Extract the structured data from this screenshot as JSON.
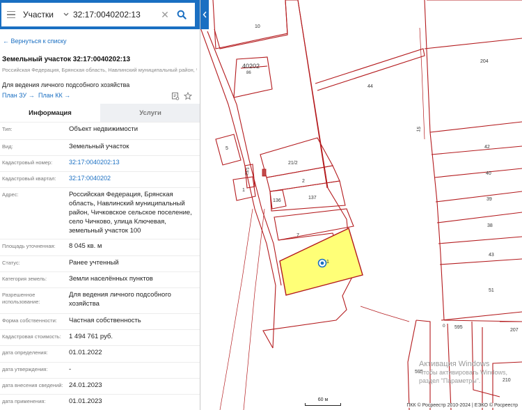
{
  "search": {
    "layer": "Участки",
    "query": "32:17:0040202:13"
  },
  "icons": {
    "menu": "hamburger-icon",
    "dropdown": "chevron-down-icon",
    "clear": "close-icon",
    "search": "search-icon",
    "collapse": "chevron-left-icon",
    "print": "print-icon",
    "favorite": "star-icon",
    "marker": "location-marker-icon"
  },
  "colors": {
    "accent": "#1a6fc2",
    "parcel_border": "#b3191c",
    "parcel_fill": "#ffff77"
  },
  "panel": {
    "back": "← Вернуться к списку",
    "title": "Земельный участок 32:17:0040202:13",
    "address": "Российская Федерация, Брянская область, Навлинский муниципальный район, Чичковское сельское поселение, село Чичково, улица Ключевая, земельный...",
    "purpose": "Для ведения личного подсобного хозяйства",
    "plan_zu": "План ЗУ →",
    "plan_kk": "План КК →"
  },
  "tabs": {
    "info": "Информация",
    "services": "Услуги"
  },
  "fields": [
    {
      "label": "Тип:",
      "value": "Объект недвижимости"
    },
    {
      "label": "Вид:",
      "value": "Земельный участок"
    },
    {
      "label": "Кадастровый номер:",
      "value": "32:17:0040202:13"
    },
    {
      "label": "Кадастровый квартал:",
      "value": "32:17:0040202"
    },
    {
      "label": "Адрес:",
      "value": "Российская Федерация, Брянская область, Навлинский муниципальный район, Чичковское сельское поселение, село Чичково, улица Ключевая, земельный участок 100"
    },
    {
      "label": "Площадь уточненная:",
      "value": "8 045 кв. м"
    },
    {
      "label": "Статус:",
      "value": "Ранее учтенный"
    },
    {
      "label": "Категория земель:",
      "value": "Земли населённых пунктов"
    },
    {
      "label": "Разрешенное использование:",
      "value": "Для ведения личного подсобного хозяйства"
    },
    {
      "label": "Форма собственности:",
      "value": "Частная собственность"
    },
    {
      "label": "Кадастровая стоимость:",
      "value": "1 494 761 руб."
    },
    {
      "label": "дата определения:",
      "value": "01.01.2022"
    },
    {
      "label": "дата утверждения:",
      "value": "-"
    },
    {
      "label": "дата внесения сведений:",
      "value": "24.01.2023"
    },
    {
      "label": "дата применения:",
      "value": "01.01.2023"
    }
  ],
  "map": {
    "labels": {
      "p10": "10",
      "p40202": "40202",
      "p86": "86",
      "p204": "204",
      "p44": "44",
      "p5": "5",
      "p21_2": "21/2",
      "p21_1": "21/1",
      "p2": "2",
      "p1": "1",
      "p136": "136",
      "p137": "137",
      "p7": "7",
      "p42": "42",
      "p40": "40",
      "p39": "39",
      "p38": "38",
      "p43": "43",
      "p51": "51",
      "p15": "15",
      "p595": "595",
      "p595b": "595",
      "p207": "207",
      "p210": "210",
      "p0": "0",
      "p1m": "1"
    },
    "scale": "60 м",
    "copyright": "ПКК © Росреестр 2010-2024 | ЕЭКО © Росреестр",
    "watermark_title": "Активация Windows",
    "watermark_text1": "Чтобы активировать Windows,",
    "watermark_text2": "раздел \"Параметры\"."
  }
}
